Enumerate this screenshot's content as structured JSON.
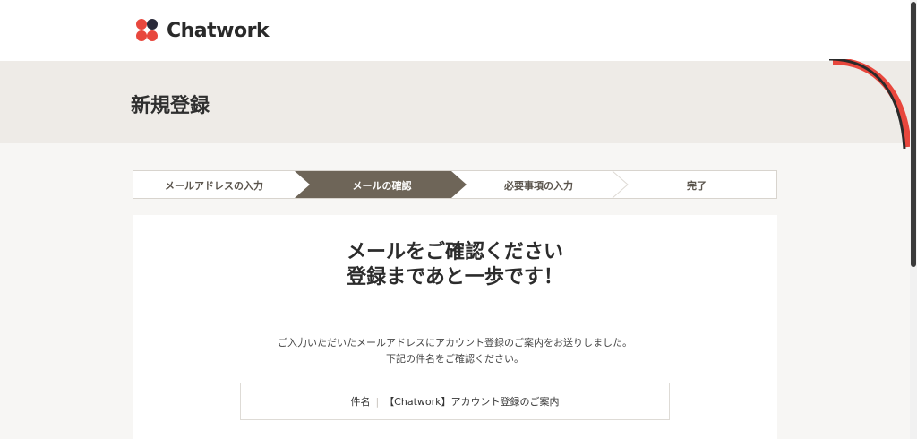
{
  "header": {
    "logo_text": "Chatwork"
  },
  "page": {
    "title": "新規登録"
  },
  "steps": [
    {
      "label": "メールアドレスの入力",
      "active": false
    },
    {
      "label": "メールの確認",
      "active": true
    },
    {
      "label": "必要事項の入力",
      "active": false
    },
    {
      "label": "完了",
      "active": false
    }
  ],
  "card": {
    "headline_line1": "メールをご確認ください",
    "headline_line2": "登録まであと一歩です！",
    "desc_line1": "ご入力いただいたメールアドレスにアカウント登録のご案内をお送りしました。",
    "desc_line2": "下記の件名をご確認ください。",
    "subject_label": "件名",
    "subject_separator": "|",
    "subject_value": "【Chatwork】アカウント登録のご案内"
  },
  "colors": {
    "step_active": "#6e6558",
    "accent_red": "#e8473d",
    "band": "#eeebe7"
  }
}
